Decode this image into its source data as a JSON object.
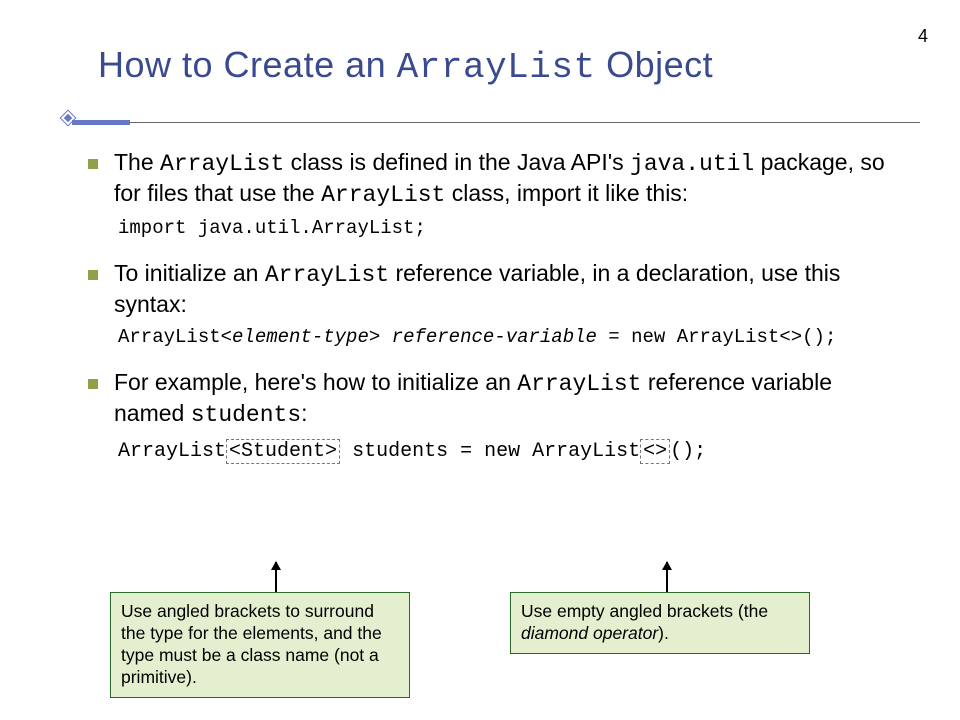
{
  "page_number": "4",
  "title": {
    "pre": "How to Create an ",
    "code": "ArrayList",
    "post": " Object"
  },
  "bullets": [
    {
      "segments": {
        "a": "The ",
        "b": "ArrayList",
        "c": " class is defined in the Java API's ",
        "d": "java.util",
        "e": " package, so for files that use the ",
        "f": "ArrayList",
        "g": " class, import it like this:"
      },
      "code": "import java.util.ArrayList;"
    },
    {
      "segments": {
        "a": "To initialize an ",
        "b": "ArrayList",
        "c": " reference variable, in a declaration, use this syntax:"
      },
      "code": {
        "a": "ArrayList<",
        "b": "element-type",
        "c": "> ",
        "d": "reference-variable",
        "e": " = new ArrayList<>();"
      }
    },
    {
      "segments": {
        "a": "For example, here's how to initialize an ",
        "b": "ArrayList",
        "c": " reference variable named ",
        "d": "students",
        "e": ":"
      },
      "example": {
        "a": "ArrayList",
        "b": "<Student>",
        "c": " students = new ArrayList",
        "d": "<>",
        "e": "();"
      }
    }
  ],
  "callout_left": "Use angled brackets to surround the type for the elements, and the type must be a class name (not a primitive).",
  "callout_right": {
    "a": "Use empty angled brackets (the ",
    "b": "diamond operator",
    "c": ")."
  }
}
